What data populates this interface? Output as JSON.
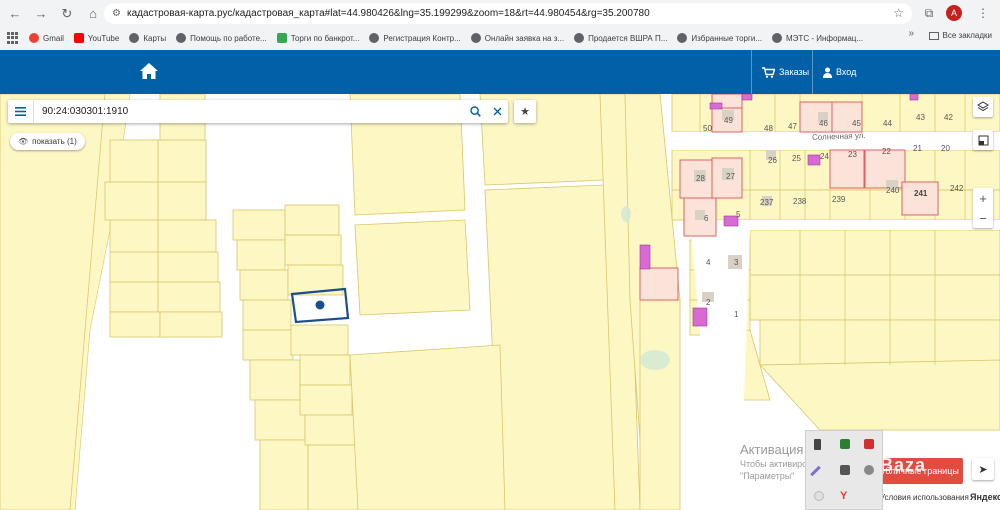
{
  "browser": {
    "url": "кадастровая-карта.рус/кадастровая_карта#lat=44.980426&lng=35.199299&zoom=18&rt=44.980454&rg=35.200780",
    "bookmarks": [
      "Gmail",
      "YouTube",
      "Карты",
      "Помощь по работе...",
      "Торги по банкрот...",
      "Регистрация Контр...",
      "Онлайн заявка на з...",
      "Продается ВШРА П...",
      "Избранные торги...",
      "МЭТС - Информац..."
    ],
    "more": "»",
    "all_bookmarks": "Все закладки",
    "avatar_letter": "A"
  },
  "site": {
    "orders_label": "Заказы",
    "login_label": "Вход"
  },
  "search": {
    "value": "90:24:030301:1910",
    "show_label": "показать (1)"
  },
  "map": {
    "street_label": "Солнечная ул.",
    "parcel_numbers": [
      "50",
      "49",
      "48",
      "47",
      "46",
      "45",
      "44",
      "43",
      "42",
      "28",
      "27",
      "26",
      "25",
      "24",
      "23",
      "22",
      "21",
      "20",
      "6",
      "5",
      "237",
      "238",
      "239",
      "240",
      "241",
      "242",
      "4",
      "3",
      "2",
      "1"
    ],
    "watermark_title": "Активация Windows",
    "watermark_line1": "Чтобы активировать Windows, перейдите в раздел",
    "watermark_line2": "\"Параметры\"",
    "red_button": "Публичные границы",
    "brand": "Baza",
    "terms": "Условия использования",
    "provider": "Яндекс"
  },
  "colors": {
    "header": "#0160a8",
    "parcel_fill": "#fdf7c4",
    "parcel_stroke": "#d8c66a",
    "selected": "#1a4f8b",
    "building": "#d86bd3",
    "red_parcel": "#e06060"
  }
}
